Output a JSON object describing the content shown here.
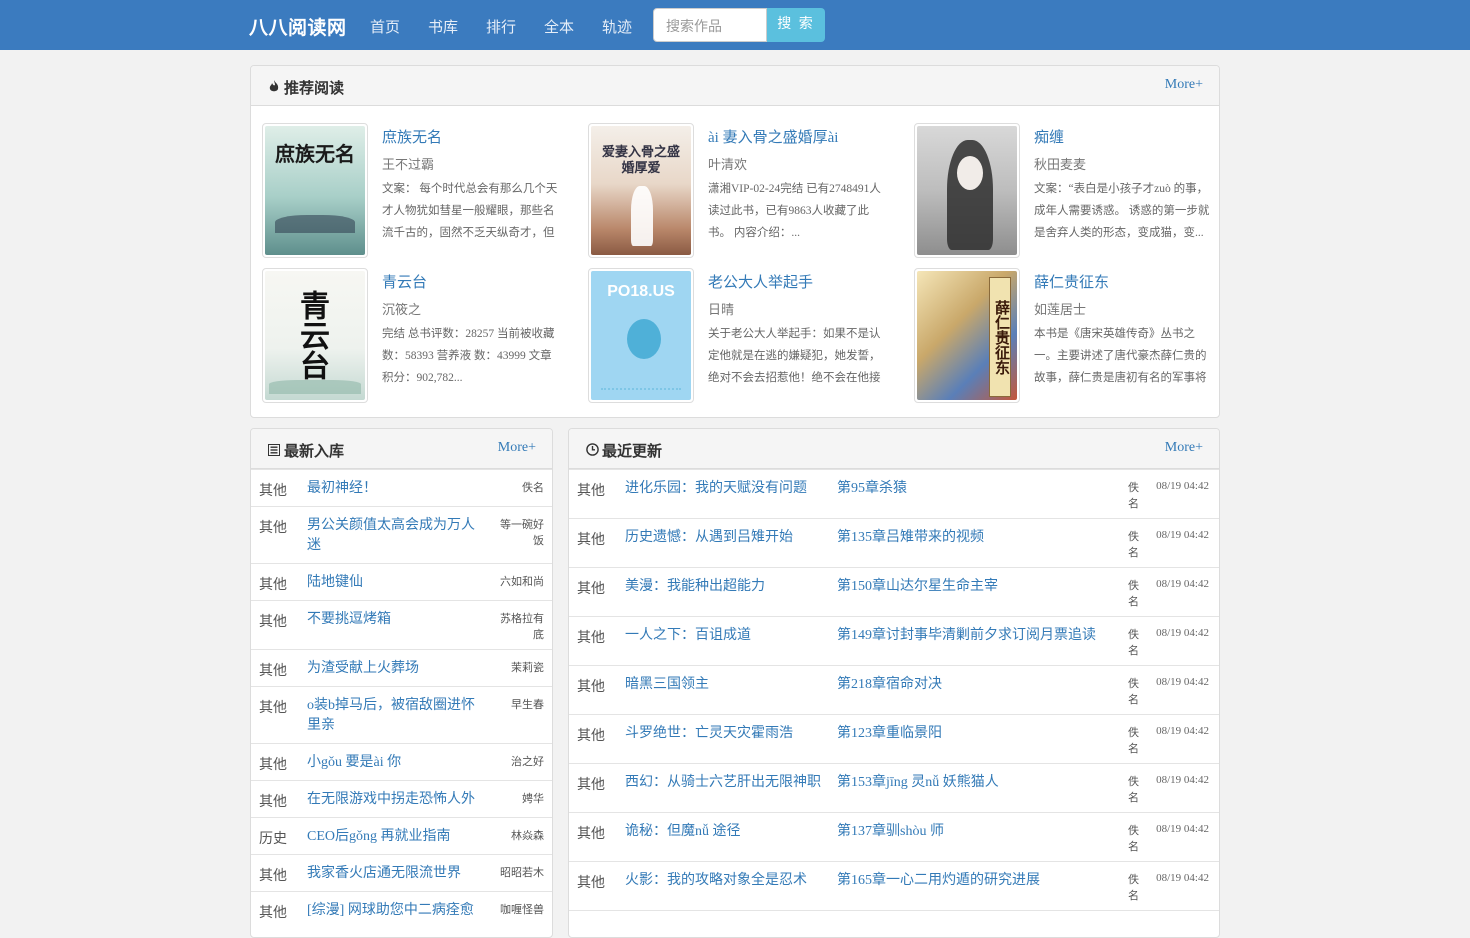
{
  "navbar": {
    "brand": "八八阅读网",
    "items": [
      "首页",
      "书库",
      "排行",
      "全本",
      "轨迹"
    ],
    "search_placeholder": "搜索作品",
    "search_button": "搜 索"
  },
  "recommend": {
    "title": "推荐阅读",
    "more": "More+",
    "icon": "fire-icon",
    "books": [
      {
        "title": "庶族无名",
        "author": "王不过霸",
        "desc": "文案： 每个时代总会有那么几个天才人物犹如彗星一般耀眼，那些名流千古的，固然不乏天纵奇才，但",
        "cover_text": "庶族无名"
      },
      {
        "title": "ài 妻入骨之盛婚厚ài",
        "author": "叶清欢",
        "desc": "潇湘VIP-02-24完结 已有2748491人读过此书，已有9863人收藏了此书。 内容介绍：...",
        "cover_text": "爱妻入骨之盛婚厚爱"
      },
      {
        "title": "痴缠",
        "author": "秋田麦麦",
        "desc": "文案：“表白是小孩子才zuò 的事，成年人需要诱惑。 诱惑的第一步就是舍弃人类的形态，变成猫，变...",
        "cover_text": ""
      },
      {
        "title": "青云台",
        "author": "沉筱之",
        "desc": "完结 总书评数：28257 当前被收藏数：58393 营养液 数：43999 文章积分：902,782...",
        "cover_text": "青云台"
      },
      {
        "title": "老公大人举起手",
        "author": "日晴",
        "desc": "关于老公大人举起手：如果不是认定他就是在逃的嫌疑犯，她发誓，绝对不会去招惹他！绝不会在他接",
        "cover_text": "PO18.US"
      },
      {
        "title": "薛仁贵征东",
        "author": "如莲居士",
        "desc": "本书是《唐宋英雄传奇》丛书之一。主要讲述了唐代豪杰薛仁贵的故事，薛仁贵是唐初有名的军事将",
        "cover_text": "薛仁贵征东"
      }
    ]
  },
  "newest": {
    "title": "最新入库",
    "more": "More+",
    "icon": "list-icon",
    "rows": [
      {
        "cat": "其他",
        "title": "最初神经！",
        "author": "佚名"
      },
      {
        "cat": "其他",
        "title": "男公关颜值太高会成为万人迷",
        "author": "等一碗好饭"
      },
      {
        "cat": "其他",
        "title": "陆地键仙",
        "author": "六如和尚"
      },
      {
        "cat": "其他",
        "title": "不要挑逗烤箱",
        "author": "苏格拉有底"
      },
      {
        "cat": "其他",
        "title": "为渣受献上火葬场",
        "author": "茉莉瓷"
      },
      {
        "cat": "其他",
        "title": "o装b掉马后，被宿敌圈进怀里亲",
        "author": "早生春"
      },
      {
        "cat": "其他",
        "title": "小gǒu 要是ài 你",
        "author": "治之好"
      },
      {
        "cat": "其他",
        "title": "在无限游戏中拐走恐怖人外",
        "author": "娉华"
      },
      {
        "cat": "历史",
        "title": "CEO后gǒng 再就业指南",
        "author": "林焱森"
      },
      {
        "cat": "其他",
        "title": "我家香火店通无限流世界",
        "author": "昭昭若木"
      },
      {
        "cat": "其他",
        "title": "[综漫] 网球助您中二病痊愈",
        "author": "咖喱怪兽"
      }
    ]
  },
  "updates": {
    "title": "最近更新",
    "more": "More+",
    "icon": "clock-icon",
    "rows": [
      {
        "cat": "其他",
        "title": "进化乐园：我的天赋没有问题",
        "chapter": "第95章杀猿",
        "author": "佚名",
        "time": "08/19 04:42"
      },
      {
        "cat": "其他",
        "title": "历史遗憾：从遇到吕雉开始",
        "chapter": "第135章吕雉带来的视频",
        "author": "佚名",
        "time": "08/19 04:42"
      },
      {
        "cat": "其他",
        "title": "美漫：我能种出超能力",
        "chapter": "第150章山达尔星生命主宰",
        "author": "佚名",
        "time": "08/19 04:42"
      },
      {
        "cat": "其他",
        "title": "一人之下：百诅成道",
        "chapter": "第149章讨封事毕清剿前夕求订阅月票追读",
        "author": "佚名",
        "time": "08/19 04:42"
      },
      {
        "cat": "其他",
        "title": "暗黑三国领主",
        "chapter": "第218章宿命对决",
        "author": "佚名",
        "time": "08/19 04:42"
      },
      {
        "cat": "其他",
        "title": "斗罗绝世：亡灵天灾霍雨浩",
        "chapter": "第123章重临景阳",
        "author": "佚名",
        "time": "08/19 04:42"
      },
      {
        "cat": "其他",
        "title": "西幻：从骑士六艺肝出无限神职",
        "chapter": "第153章jīng 灵nǚ 妖熊猫人",
        "author": "佚名",
        "time": "08/19 04:42"
      },
      {
        "cat": "其他",
        "title": "诡秘：但魔nǚ 途径",
        "chapter": "第137章驯shòu 师",
        "author": "佚名",
        "time": "08/19 04:42"
      },
      {
        "cat": "其他",
        "title": "火影：我的攻略对象全是忍术",
        "chapter": "第165章一心二用灼遁的研究进展",
        "author": "佚名",
        "time": "08/19 04:42"
      }
    ]
  }
}
